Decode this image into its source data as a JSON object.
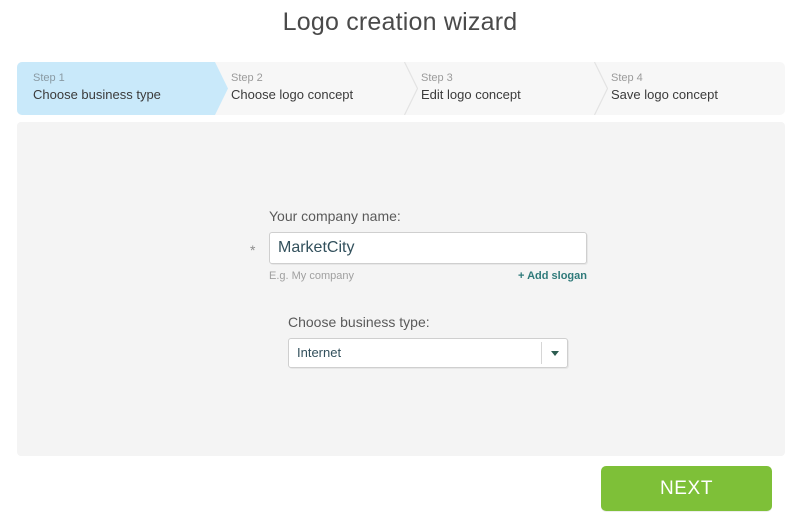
{
  "page": {
    "title": "Logo creation wizard"
  },
  "steps": [
    {
      "num": "Step 1",
      "label": "Choose business type",
      "active": true
    },
    {
      "num": "Step 2",
      "label": "Choose logo concept",
      "active": false
    },
    {
      "num": "Step 3",
      "label": "Edit logo concept",
      "active": false
    },
    {
      "num": "Step 4",
      "label": "Save logo concept",
      "active": false
    }
  ],
  "form": {
    "company_name_label": "Your company name:",
    "required_marker": "*",
    "company_name_value": "MarketCity",
    "company_name_placeholder": "My company",
    "company_name_hint": "E.g. My company",
    "add_slogan_link": "+ Add slogan",
    "business_type_label": "Choose business type:",
    "business_type_value": "Internet",
    "business_type_options": [
      "Internet"
    ]
  },
  "footer": {
    "next_label": "NEXT"
  },
  "colors": {
    "active_step_bg": "#c9e9fa",
    "step_bar_bg": "#f7f7f7",
    "panel_bg": "#f4f4f4",
    "next_button": "#7ec038",
    "link_teal": "#2f7a7a",
    "input_text": "#32505c"
  }
}
